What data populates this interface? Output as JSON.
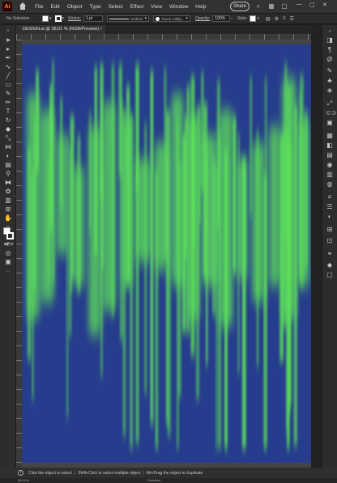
{
  "app": {
    "logo": "Ai"
  },
  "menu": [
    "File",
    "Edit",
    "Object",
    "Type",
    "Select",
    "Effect",
    "View",
    "Window",
    "Help"
  ],
  "share_label": "Share",
  "control_bar": {
    "selection_label": "No Selection",
    "stroke_label": "Stroke:",
    "stroke_weight": "1 pt",
    "profile": "Uniform",
    "brush": "Touch Callig...",
    "opacity_label": "Opacity:",
    "opacity_value": "100%",
    "style_label": "Style:"
  },
  "document_tab": {
    "title": "DESIGN.ai @ 38,01 % (RGB/Preview)",
    "close": "×"
  },
  "status": {
    "hint_parts": [
      "Click the object to select",
      "Shift+Click to select multiple object",
      "Alt+Drag the object to duplicate"
    ],
    "zoom": "38.01%",
    "mode": "Selection"
  },
  "colors": {
    "artboard_bg": "#263c8c",
    "stroke_green": "#5de05a",
    "ui_dark": "#2d2d2d"
  },
  "icons": {
    "left_tools": [
      "selection-tool-icon",
      "direct-selection-icon",
      "pen-tool-icon",
      "curvature-tool-icon",
      "line-tool-icon",
      "rectangle-tool-icon",
      "paintbrush-icon",
      "pencil-icon",
      "type-tool-icon",
      "rotate-icon",
      "eraser-icon",
      "scale-icon",
      "width-tool-icon",
      "shape-builder-icon",
      "gradient-icon",
      "eyedropper-icon",
      "blend-icon",
      "symbol-sprayer-icon",
      "graph-icon",
      "artboard-tool-icon",
      "slice-icon",
      "hand-icon",
      "zoom-icon"
    ],
    "right_panels": [
      "properties-icon",
      "paragraph-icon",
      "glyphs-icon",
      "brushes-icon",
      "symbols-icon",
      "graphic-styles-icon",
      "links-icon",
      "appearance-icon",
      "transform-icon",
      "align-icon",
      "pathfinder-icon",
      "swatches-icon",
      "color-icon",
      "gradient-panel-icon",
      "transparency-icon",
      "stroke-panel-icon",
      "layers-icon",
      "artboards-icon",
      "libraries-icon",
      "asset-export-icon",
      "image-trace-icon"
    ]
  }
}
